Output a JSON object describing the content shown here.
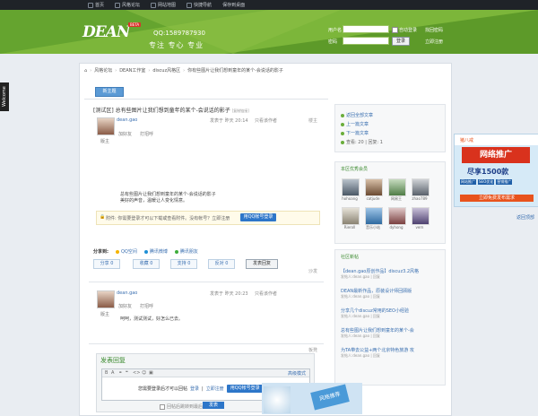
{
  "top_nav": [
    "首页",
    "风格论坛",
    "网站地图",
    "快捷导航",
    "保存到桌面"
  ],
  "banner": {
    "logo": "DEAN",
    "logo_badge": "BETA",
    "qq": "QQ:1589787930",
    "slogan": "专注 专心 专业"
  },
  "login": {
    "username_label": "用户名",
    "password_label": "密码",
    "auto_login": "自动登录",
    "forgot": "找回密码",
    "login_button": "登录",
    "register": "立即注册"
  },
  "welcome_tab": "Welcome",
  "breadcrumb": [
    "风格论坛",
    "DEAN工作室",
    "discuz风格区",
    "你有些图片让我们想到童年的某个-会说话的影子"
  ],
  "new_topic_button": "新主题",
  "thread": {
    "title": "[测试区] 总有些图片让我们想到童年的某个-会说话的影子",
    "copy_link": "[复制链接]"
  },
  "post1": {
    "author": "dean.gao",
    "time": "发表于 昨天 20:14",
    "only_author": "只看该作者",
    "add_friend": "加好友",
    "greet": "打招呼",
    "rank": "版主",
    "content": [
      "总有些图片让我们想到童年的某个-会说话的影子",
      "美好的声音，温暖让人变化情意。"
    ],
    "attachment": "附件: 你需要登录才可以下载或查看附件。没有帐号？立即注册",
    "qq_login": "用QQ帐号登录",
    "share_label": "分享到:",
    "share_items": [
      "QQ空间",
      "腾讯微博",
      "腾讯朋友"
    ],
    "actions": [
      "分享 0",
      "收藏 0",
      "支持 0",
      "反对 0",
      "发表回复"
    ],
    "floor": "楼主"
  },
  "post2": {
    "author": "dean.gao",
    "time": "发表于 昨天 20:23",
    "only_author": "只看该作者",
    "add_friend": "加好友",
    "greet": "打招呼",
    "rank": "版主",
    "content": "呵呵，测试测试，好怎么已去。",
    "floor": "沙发"
  },
  "reply": {
    "heading": "发表回复",
    "advanced": "高级模式",
    "login_prompt": "您需要登录后才可以回帖",
    "login": "登录",
    "register": "立即注册",
    "qq_login": "用QQ帐号登录",
    "notify": "回帖后跳转到最后一页",
    "publish": "发表",
    "floor": "板凳"
  },
  "sidebar": {
    "return_list": "返回全部文章",
    "prev": "上一篇文章",
    "next": "下一篇文章",
    "stats": "查看: 20  |  回复: 1",
    "members_title": "本区优秀会员",
    "members": [
      "hohoang",
      "catjude",
      "网易王",
      "zhao789",
      "Rieroll",
      "音乐小站",
      "dyhong",
      "vern"
    ],
    "news_title": "社区新帖",
    "news": [
      {
        "title": "【dean.gao原创作品】discuz3.2风格",
        "sub": "发帖人:dean.gao | 回复"
      },
      {
        "title": "DEAN最新作品，原装设计师回顾版",
        "sub": "发帖人:dean.gao | 回复"
      },
      {
        "title": "分享几个discuz常用的SEO小经验",
        "sub": "发帖人:dean.gao | 回复"
      },
      {
        "title": "总有些图片让我们想到童年的某个-会",
        "sub": "发帖人:dean.gao | 回复"
      },
      {
        "title": "为TA带去公益+两个北京特色旅游 攻",
        "sub": "发帖人:dean.gao | 回复"
      }
    ]
  },
  "ad": {
    "top": "猪八戒",
    "big": "网络推广",
    "mid": "尽享1500款",
    "tags": [
      "网站推广",
      "SEO优化",
      "营销推广"
    ],
    "bottom": "立即免费发布需求"
  },
  "back_top": "返回顶部",
  "pic_text": "风格推荐"
}
